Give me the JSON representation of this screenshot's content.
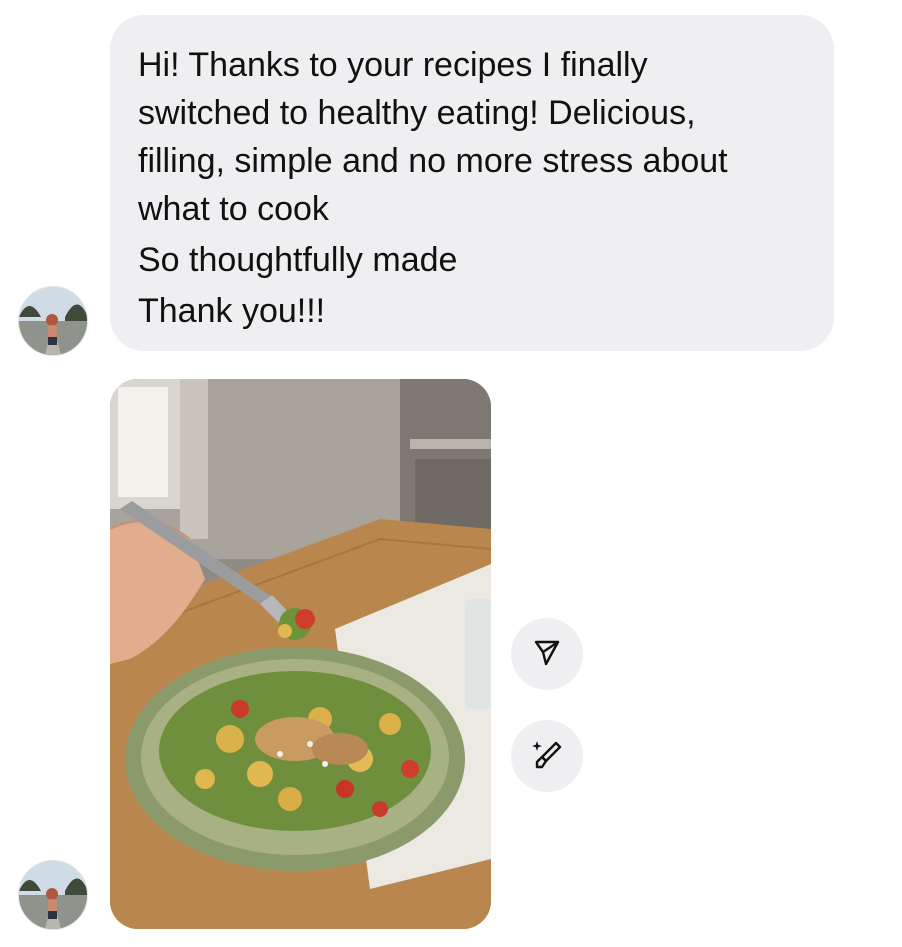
{
  "message": {
    "lines": [
      "Hi! Thanks to your recipes I finally",
      "switched to healthy eating! Delicious,",
      "filling, simple and no more stress about",
      "what to cook",
      "So thoughtfully made",
      "Thank you!!!"
    ]
  },
  "icons": {
    "share": "paper-plane-icon",
    "edit": "sparkle-brush-icon"
  }
}
